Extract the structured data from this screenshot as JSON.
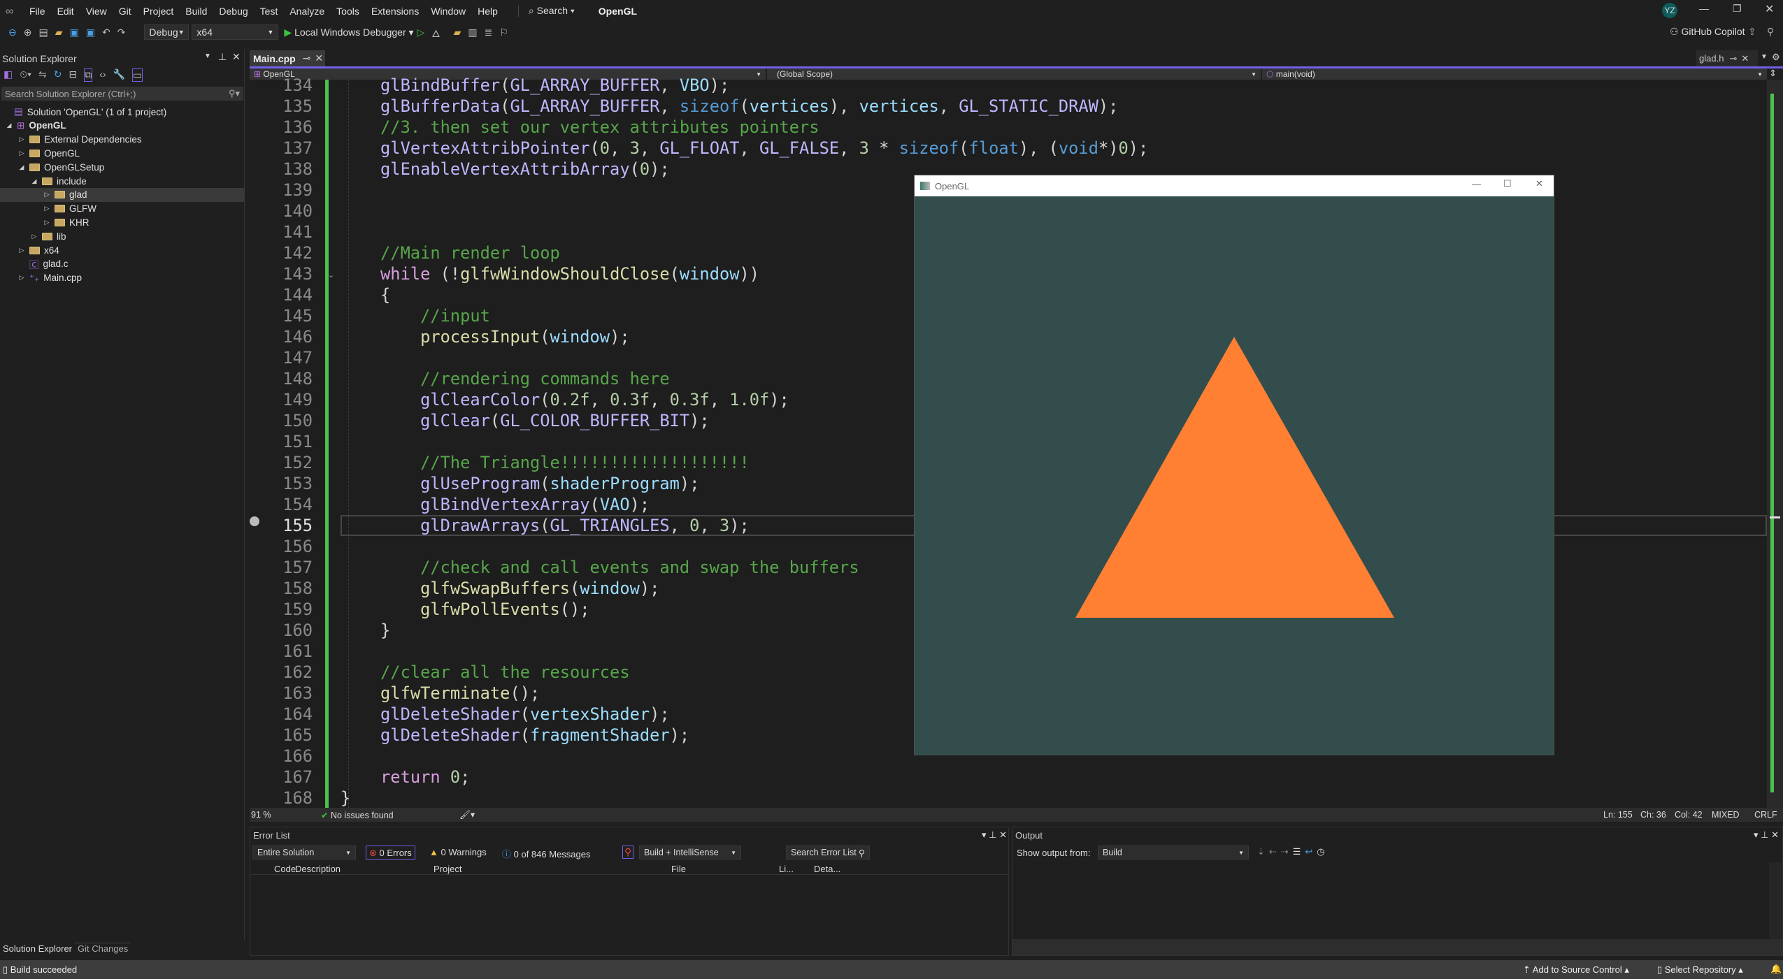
{
  "menubar": {
    "items": [
      "File",
      "Edit",
      "View",
      "Git",
      "Project",
      "Build",
      "Debug",
      "Test",
      "Analyze",
      "Tools",
      "Extensions",
      "Window",
      "Help"
    ],
    "search": "Search",
    "solution_title": "OpenGL",
    "avatar": "YZ"
  },
  "toolbar": {
    "config": "Debug",
    "platform": "x64",
    "run_label": "Local Windows Debugger",
    "copilot": "GitHub Copilot"
  },
  "solution_explorer": {
    "title": "Solution Explorer",
    "search_placeholder": "Search Solution Explorer (Ctrl+;)",
    "items": [
      {
        "label": "Solution 'OpenGL' (1 of 1 project)",
        "level": 0,
        "arrow": "",
        "icon": "solution"
      },
      {
        "label": "OpenGL",
        "level": 0,
        "arrow": "open",
        "icon": "project",
        "bold": true
      },
      {
        "label": "External Dependencies",
        "level": 1,
        "arrow": "closed",
        "icon": "folder"
      },
      {
        "label": "OpenGL",
        "level": 1,
        "arrow": "closed",
        "icon": "folder"
      },
      {
        "label": "OpenGLSetup",
        "level": 1,
        "arrow": "open",
        "icon": "folder"
      },
      {
        "label": "include",
        "level": 2,
        "arrow": "open",
        "icon": "folder"
      },
      {
        "label": "glad",
        "level": 3,
        "arrow": "closed",
        "icon": "folder",
        "selected": true
      },
      {
        "label": "GLFW",
        "level": 3,
        "arrow": "closed",
        "icon": "folder"
      },
      {
        "label": "KHR",
        "level": 3,
        "arrow": "closed",
        "icon": "folder"
      },
      {
        "label": "lib",
        "level": 2,
        "arrow": "closed",
        "icon": "folder"
      },
      {
        "label": "x64",
        "level": 1,
        "arrow": "closed",
        "icon": "folder"
      },
      {
        "label": "glad.c",
        "level": 1,
        "arrow": "",
        "icon": "c-file"
      },
      {
        "label": "Main.cpp",
        "level": 1,
        "arrow": "closed",
        "icon": "cpp-file"
      }
    ],
    "bottom_tabs": [
      "Solution Explorer",
      "Git Changes"
    ]
  },
  "editor": {
    "tab": "Main.cpp",
    "other_tab": "glad.h",
    "nav_project": "OpenGL",
    "nav_scope": "(Global Scope)",
    "nav_member": "main(void)",
    "current_line": 155,
    "lines": [
      {
        "n": 134,
        "t": [
          [
            "    ",
            " p"
          ],
          [
            "glBindBuffer",
            "m"
          ],
          [
            "(",
            "p"
          ],
          [
            "GL_ARRAY_BUFFER",
            "m"
          ],
          [
            ", ",
            "p"
          ],
          [
            "VBO",
            "v"
          ],
          [
            ");",
            "p"
          ]
        ]
      },
      {
        "n": 135,
        "t": [
          [
            "    ",
            "p"
          ],
          [
            "glBufferData",
            "m"
          ],
          [
            "(",
            "p"
          ],
          [
            "GL_ARRAY_BUFFER",
            "m"
          ],
          [
            ", ",
            "p"
          ],
          [
            "sizeof",
            "k"
          ],
          [
            "(",
            "p"
          ],
          [
            "vertices",
            "v"
          ],
          [
            "), ",
            "p"
          ],
          [
            "vertices",
            "v"
          ],
          [
            ", ",
            "p"
          ],
          [
            "GL_STATIC_DRAW",
            "m"
          ],
          [
            ");",
            "p"
          ]
        ]
      },
      {
        "n": 136,
        "t": [
          [
            "    ",
            "p"
          ],
          [
            "//3. then set our vertex attributes pointers",
            "cm"
          ]
        ]
      },
      {
        "n": 137,
        "t": [
          [
            "    ",
            "p"
          ],
          [
            "glVertexAttribPointer",
            "m"
          ],
          [
            "(",
            "p"
          ],
          [
            "0",
            "n"
          ],
          [
            ", ",
            "p"
          ],
          [
            "3",
            "n"
          ],
          [
            ", ",
            "p"
          ],
          [
            "GL_FLOAT",
            "m"
          ],
          [
            ", ",
            "p"
          ],
          [
            "GL_FALSE",
            "m"
          ],
          [
            ", ",
            "p"
          ],
          [
            "3",
            "n"
          ],
          [
            " * ",
            "p"
          ],
          [
            "sizeof",
            "k"
          ],
          [
            "(",
            "p"
          ],
          [
            "float",
            "k"
          ],
          [
            "), (",
            "p"
          ],
          [
            "void",
            "k"
          ],
          [
            "*)",
            "p"
          ],
          [
            "0",
            "n"
          ],
          [
            ");",
            "p"
          ]
        ]
      },
      {
        "n": 138,
        "t": [
          [
            "    ",
            "p"
          ],
          [
            "glEnableVertexAttribArray",
            "m"
          ],
          [
            "(",
            "p"
          ],
          [
            "0",
            "n"
          ],
          [
            ");",
            "p"
          ]
        ]
      },
      {
        "n": 139,
        "t": []
      },
      {
        "n": 140,
        "t": []
      },
      {
        "n": 141,
        "t": []
      },
      {
        "n": 142,
        "t": [
          [
            "    ",
            "p"
          ],
          [
            "//Main render loop",
            "cm"
          ]
        ]
      },
      {
        "n": 143,
        "t": [
          [
            "    ",
            "p"
          ],
          [
            "while",
            "c"
          ],
          [
            " (!",
            "p"
          ],
          [
            "glfwWindowShouldClose",
            "f"
          ],
          [
            "(",
            "p"
          ],
          [
            "window",
            "v"
          ],
          [
            "))",
            "p"
          ]
        ]
      },
      {
        "n": 144,
        "t": [
          [
            "    {",
            "p"
          ]
        ]
      },
      {
        "n": 145,
        "t": [
          [
            "        ",
            "p"
          ],
          [
            "//input",
            "cm"
          ]
        ]
      },
      {
        "n": 146,
        "t": [
          [
            "        ",
            "p"
          ],
          [
            "processInput",
            "f"
          ],
          [
            "(",
            "p"
          ],
          [
            "window",
            "v"
          ],
          [
            ");",
            "p"
          ]
        ]
      },
      {
        "n": 147,
        "t": []
      },
      {
        "n": 148,
        "t": [
          [
            "        ",
            "p"
          ],
          [
            "//rendering commands here",
            "cm"
          ]
        ]
      },
      {
        "n": 149,
        "t": [
          [
            "        ",
            "p"
          ],
          [
            "glClearColor",
            "m"
          ],
          [
            "(",
            "p"
          ],
          [
            "0.2f",
            "n"
          ],
          [
            ", ",
            "p"
          ],
          [
            "0.3f",
            "n"
          ],
          [
            ", ",
            "p"
          ],
          [
            "0.3f",
            "n"
          ],
          [
            ", ",
            "p"
          ],
          [
            "1.0f",
            "n"
          ],
          [
            ");",
            "p"
          ]
        ]
      },
      {
        "n": 150,
        "t": [
          [
            "        ",
            "p"
          ],
          [
            "glClear",
            "m"
          ],
          [
            "(",
            "p"
          ],
          [
            "GL_COLOR_BUFFER_BIT",
            "m"
          ],
          [
            ");",
            "p"
          ]
        ]
      },
      {
        "n": 151,
        "t": []
      },
      {
        "n": 152,
        "t": [
          [
            "        ",
            "p"
          ],
          [
            "//The Triangle!!!!!!!!!!!!!!!!!!!",
            "cm"
          ]
        ]
      },
      {
        "n": 153,
        "t": [
          [
            "        ",
            "p"
          ],
          [
            "glUseProgram",
            "m"
          ],
          [
            "(",
            "p"
          ],
          [
            "shaderProgram",
            "v"
          ],
          [
            ");",
            "p"
          ]
        ]
      },
      {
        "n": 154,
        "t": [
          [
            "        ",
            "p"
          ],
          [
            "glBindVertexArray",
            "m"
          ],
          [
            "(",
            "p"
          ],
          [
            "VAO",
            "v"
          ],
          [
            ");",
            "p"
          ]
        ]
      },
      {
        "n": 155,
        "t": [
          [
            "        ",
            "p"
          ],
          [
            "glDrawArrays",
            "m"
          ],
          [
            "(",
            "p"
          ],
          [
            "GL_TRIANGLES",
            "m"
          ],
          [
            ", ",
            "p"
          ],
          [
            "0",
            "n"
          ],
          [
            ", ",
            "p"
          ],
          [
            "3",
            "n"
          ],
          [
            ");",
            "p"
          ]
        ]
      },
      {
        "n": 156,
        "t": []
      },
      {
        "n": 157,
        "t": [
          [
            "        ",
            "p"
          ],
          [
            "//check and call events and swap the buffers",
            "cm"
          ]
        ]
      },
      {
        "n": 158,
        "t": [
          [
            "        ",
            "p"
          ],
          [
            "glfwSwapBuffers",
            "f"
          ],
          [
            "(",
            "p"
          ],
          [
            "window",
            "v"
          ],
          [
            ");",
            "p"
          ]
        ]
      },
      {
        "n": 159,
        "t": [
          [
            "        ",
            "p"
          ],
          [
            "glfwPollEvents",
            "f"
          ],
          [
            "();",
            "p"
          ]
        ]
      },
      {
        "n": 160,
        "t": [
          [
            "    }",
            "p"
          ]
        ]
      },
      {
        "n": 161,
        "t": []
      },
      {
        "n": 162,
        "t": [
          [
            "    ",
            "p"
          ],
          [
            "//clear all the resources",
            "cm"
          ]
        ]
      },
      {
        "n": 163,
        "t": [
          [
            "    ",
            "p"
          ],
          [
            "glfwTerminate",
            "f"
          ],
          [
            "();",
            "p"
          ]
        ]
      },
      {
        "n": 164,
        "t": [
          [
            "    ",
            "p"
          ],
          [
            "glDeleteShader",
            "m"
          ],
          [
            "(",
            "p"
          ],
          [
            "vertexShader",
            "v"
          ],
          [
            ");",
            "p"
          ]
        ]
      },
      {
        "n": 165,
        "t": [
          [
            "    ",
            "p"
          ],
          [
            "glDeleteShader",
            "m"
          ],
          [
            "(",
            "p"
          ],
          [
            "fragmentShader",
            "v"
          ],
          [
            ");",
            "p"
          ]
        ]
      },
      {
        "n": 166,
        "t": []
      },
      {
        "n": 167,
        "t": [
          [
            "    ",
            "p"
          ],
          [
            "return",
            "c"
          ],
          [
            " ",
            "p"
          ],
          [
            "0",
            "n"
          ],
          [
            ";",
            "p"
          ]
        ]
      },
      {
        "n": 168,
        "t": [
          [
            "}",
            "p"
          ]
        ]
      }
    ],
    "status": {
      "zoom": "91 %",
      "issues": "No issues found",
      "ln": "Ln: 155",
      "ch": "Ch: 36",
      "col": "Col: 42",
      "whitespace": "MIXED",
      "eol": "CRLF"
    }
  },
  "opengl_window": {
    "title": "OpenGL",
    "clear_color": "#334d4d",
    "triangle_color": "#ff7f33"
  },
  "error_list": {
    "title": "Error List",
    "scope": "Entire Solution",
    "errors": "0 Errors",
    "warnings": "0 Warnings",
    "messages": "0 of 846 Messages",
    "source": "Build + IntelliSense",
    "search_placeholder": "Search Error List",
    "columns": [
      "Code",
      "Description",
      "Project",
      "File",
      "Li...",
      "Deta..."
    ]
  },
  "output": {
    "title": "Output",
    "show_from_label": "Show output from:",
    "source": "Build"
  },
  "statusbar": {
    "message": "Build succeeded",
    "source_control": "Add to Source Control",
    "repository": "Select Repository"
  },
  "colors": {
    "accent": "#7160e8",
    "change_bar": "#4ec04e"
  }
}
